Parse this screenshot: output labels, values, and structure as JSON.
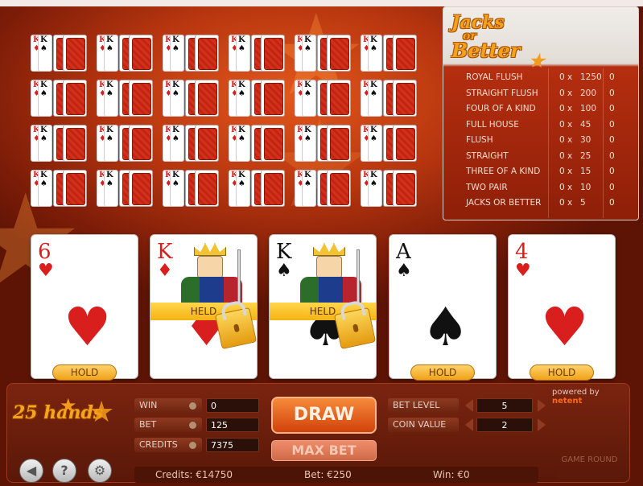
{
  "paytable": {
    "logo": {
      "line1": "Jacks",
      "line2": "or",
      "line3": "Better"
    },
    "rows": [
      {
        "hand": "ROYAL FLUSH",
        "count": "0 x",
        "pay": "1250",
        "win": "0"
      },
      {
        "hand": "STRAIGHT FLUSH",
        "count": "0 x",
        "pay": "200",
        "win": "0"
      },
      {
        "hand": "FOUR OF A KIND",
        "count": "0 x",
        "pay": "100",
        "win": "0"
      },
      {
        "hand": "FULL HOUSE",
        "count": "0 x",
        "pay": "45",
        "win": "0"
      },
      {
        "hand": "FLUSH",
        "count": "0 x",
        "pay": "30",
        "win": "0"
      },
      {
        "hand": "STRAIGHT",
        "count": "0 x",
        "pay": "25",
        "win": "0"
      },
      {
        "hand": "THREE OF A KIND",
        "count": "0 x",
        "pay": "15",
        "win": "0"
      },
      {
        "hand": "TWO PAIR",
        "count": "0 x",
        "pay": "10",
        "win": "0"
      },
      {
        "hand": "JACKS OR BETTER",
        "count": "0 x",
        "pay": "5",
        "win": "0"
      }
    ]
  },
  "mini_grid": {
    "rows": 4,
    "cols": 6,
    "face_ranks": [
      "K",
      "K"
    ],
    "face_suits": [
      "♦",
      "♠"
    ]
  },
  "cards": [
    {
      "rank": "6",
      "suit": "♥",
      "color": "red",
      "held": false,
      "hold_label": "HOLD"
    },
    {
      "rank": "K",
      "suit": "♦",
      "color": "red",
      "held": true,
      "held_label": "HELD"
    },
    {
      "rank": "K",
      "suit": "♠",
      "color": "black",
      "held": true,
      "held_label": "HELD"
    },
    {
      "rank": "A",
      "suit": "♠",
      "color": "black",
      "held": false,
      "hold_label": "HOLD"
    },
    {
      "rank": "4",
      "suit": "♥",
      "color": "red",
      "held": false,
      "hold_label": "HOLD"
    }
  ],
  "panel": {
    "hands_logo": "25 hands",
    "win_label": "WIN",
    "win_value": "0",
    "bet_label": "BET",
    "bet_value": "125",
    "credits_label": "CREDITS",
    "credits_value": "7375",
    "draw_label": "DRAW",
    "maxbet_label": "MAX BET",
    "bet_level_label": "BET LEVEL",
    "bet_level_value": "5",
    "coin_value_label": "COIN VALUE",
    "coin_value_value": "2",
    "powered_by": "powered by",
    "powered_brand": "netent",
    "game_round_label": "GAME ROUND",
    "icons": [
      "sound-icon",
      "help-icon",
      "settings-icon"
    ]
  },
  "status": {
    "credits": "Credits: €14750",
    "bet": "Bet: €250",
    "win": "Win: €0"
  },
  "colors": {
    "accent": "#f39b1a",
    "table_bg": "#8e1f08",
    "draw": "#d2420b"
  }
}
